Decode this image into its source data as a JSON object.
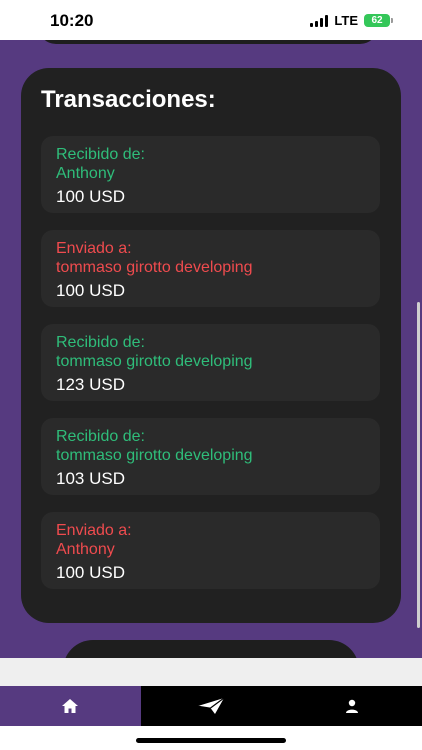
{
  "status_bar": {
    "time": "10:20",
    "network": "LTE",
    "battery": "62"
  },
  "transactions": {
    "title": "Transacciones:",
    "items": [
      {
        "direction": "received",
        "label": "Recibido de:",
        "party": "Anthony",
        "amount": "100 USD"
      },
      {
        "direction": "sent",
        "label": "Enviado a:",
        "party": "tommaso girotto developing",
        "amount": "100 USD"
      },
      {
        "direction": "received",
        "label": "Recibido de:",
        "party": "tommaso girotto developing",
        "amount": "123 USD"
      },
      {
        "direction": "received",
        "label": "Recibido de:",
        "party": "tommaso girotto developing",
        "amount": "103 USD"
      },
      {
        "direction": "sent",
        "label": "Enviado a:",
        "party": "Anthony",
        "amount": "100 USD"
      }
    ]
  },
  "tab_bar": {
    "tabs": [
      {
        "name": "home",
        "icon": "home-icon",
        "active": true
      },
      {
        "name": "send",
        "icon": "paper-plane-icon",
        "active": false
      },
      {
        "name": "profile",
        "icon": "user-icon",
        "active": false
      }
    ]
  },
  "colors": {
    "background_purple": "#563a80",
    "card": "#212121",
    "received": "#2fbd7a",
    "sent": "#ef4b4e",
    "battery": "#34c759"
  }
}
